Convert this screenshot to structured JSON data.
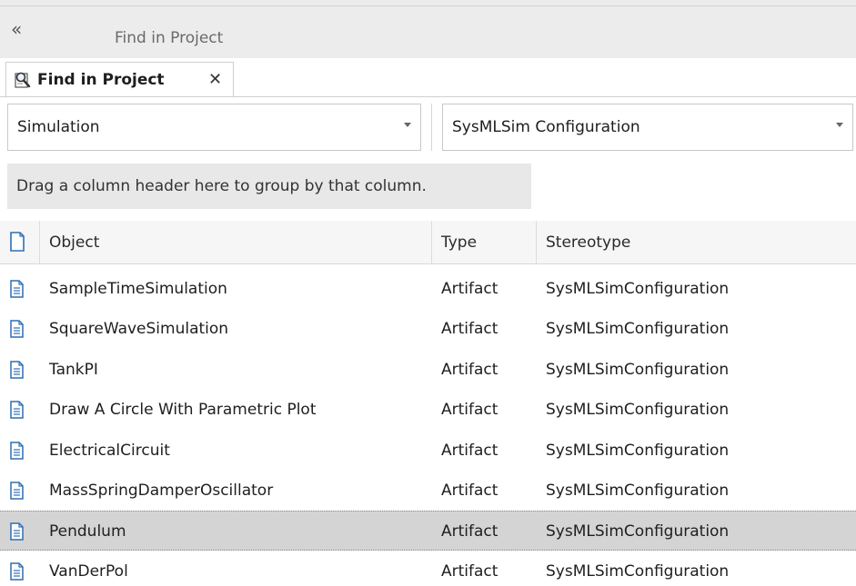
{
  "window": {
    "collapse_glyph": "«",
    "title": "Find in Project"
  },
  "tab": {
    "label": "Find in Project",
    "close_glyph": "✕",
    "icon": "search-document-icon"
  },
  "filters": {
    "category": "Simulation",
    "search": "SysMLSim Configuration"
  },
  "group_hint": "Drag a column header here to group by that column.",
  "columns": {
    "object": "Object",
    "type": "Type",
    "stereotype": "Stereotype"
  },
  "rows": [
    {
      "object": "SampleTimeSimulation",
      "type": "Artifact",
      "stereotype": "SysMLSimConfiguration"
    },
    {
      "object": "SquareWaveSimulation",
      "type": "Artifact",
      "stereotype": "SysMLSimConfiguration"
    },
    {
      "object": "TankPI",
      "type": "Artifact",
      "stereotype": "SysMLSimConfiguration"
    },
    {
      "object": "Draw A Circle With Parametric Plot",
      "type": "Artifact",
      "stereotype": "SysMLSimConfiguration"
    },
    {
      "object": "ElectricalCircuit",
      "type": "Artifact",
      "stereotype": "SysMLSimConfiguration"
    },
    {
      "object": "MassSpringDamperOscillator",
      "type": "Artifact",
      "stereotype": "SysMLSimConfiguration"
    },
    {
      "object": "Pendulum",
      "type": "Artifact",
      "stereotype": "SysMLSimConfiguration"
    },
    {
      "object": "VanDerPol",
      "type": "Artifact",
      "stereotype": "SysMLSimConfiguration"
    }
  ],
  "selected_row": "Pendulum",
  "colors": {
    "selection": "#d4d4d4",
    "icon_blue": "#2f6fb5"
  }
}
